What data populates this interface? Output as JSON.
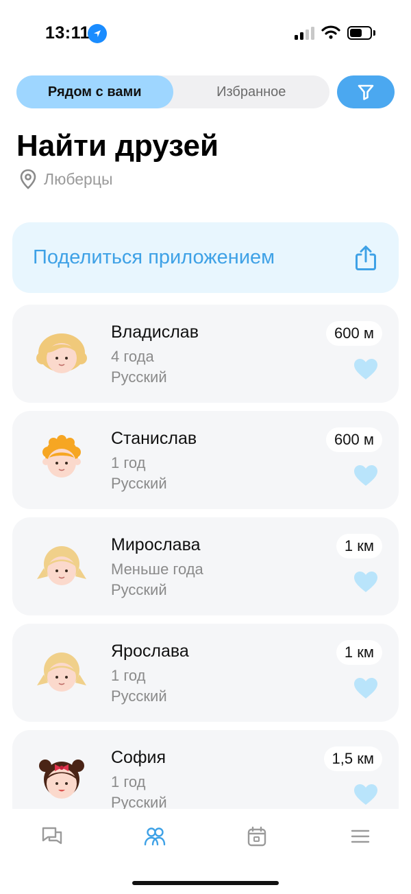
{
  "status": {
    "time": "13:11"
  },
  "segment": {
    "nearby": "Рядом с вами",
    "favorites": "Избранное"
  },
  "header": {
    "title": "Найти друзей",
    "city": "Люберцы"
  },
  "share": {
    "label": "Поделиться приложением"
  },
  "friends": [
    {
      "name": "Владислав",
      "age": "4 года",
      "language": "Русский",
      "distance": "600 м",
      "avatar": "blonde-curly-child"
    },
    {
      "name": "Станислав",
      "age": "1 год",
      "language": "Русский",
      "distance": "600 м",
      "avatar": "ginger-curly-child"
    },
    {
      "name": "Мирослава",
      "age": "Меньше года",
      "language": "Русский",
      "distance": "1 км",
      "avatar": "blonde-pigtails-child"
    },
    {
      "name": "Ярослава",
      "age": "1 год",
      "language": "Русский",
      "distance": "1 км",
      "avatar": "blonde-pigtails-child"
    },
    {
      "name": "София",
      "age": "1 год",
      "language": "Русский",
      "distance": "1,5 км",
      "avatar": "dark-hair-bow-child"
    }
  ],
  "tabs": [
    "chat-icon",
    "friends-icon",
    "calendar-icon",
    "menu-icon"
  ],
  "colors": {
    "accent": "#4ba8f0",
    "segment_active": "#9ed6ff",
    "heart": "#b9e4fb",
    "share_bg": "#e8f6fe"
  }
}
